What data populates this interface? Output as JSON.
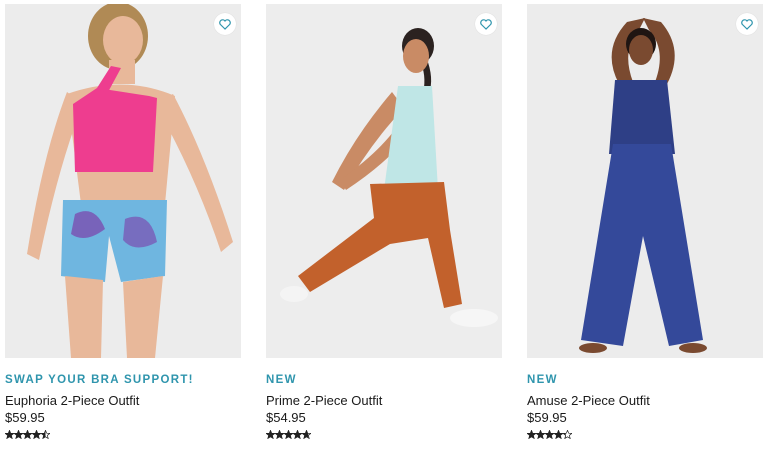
{
  "products": [
    {
      "badge": "SWAP YOUR BRA SUPPORT!",
      "name": "Euphoria 2-Piece Outfit",
      "price": "$59.95",
      "rating": 4.5,
      "wishlist_icon": "heart-outline-icon",
      "image_alt": "Model wearing pink one-shoulder sports bra and blue tie-dye shorts",
      "colors": {
        "top": "#ee3d8f",
        "bottom": "#6fb6e0",
        "bottom_accent": "#7a4fb0",
        "skin": "#e8b89a",
        "hair": "#b08a55"
      }
    },
    {
      "badge": "NEW",
      "name": "Prime 2-Piece Outfit",
      "price": "$54.95",
      "rating": 4.7,
      "wishlist_icon": "heart-outline-icon",
      "image_alt": "Model in lunge wearing light aqua tank and rust leggings",
      "colors": {
        "top": "#bfe6e6",
        "bottom": "#c2612c",
        "skin": "#c98b65",
        "hair": "#2b2220"
      }
    },
    {
      "badge": "NEW",
      "name": "Amuse 2-Piece Outfit",
      "price": "$59.95",
      "rating": 4.3,
      "wishlist_icon": "heart-outline-icon",
      "image_alt": "Model wearing navy tank and navy wide-leg pants",
      "colors": {
        "top": "#2e3f86",
        "bottom": "#34499a",
        "skin": "#7a4a30",
        "hair": "#1f1512"
      }
    }
  ],
  "colors": {
    "badge": "#2f95ad",
    "text": "#1a1a1a",
    "star": "#222222",
    "photo_bg": "#eeeeee",
    "heart": "#2f95ad"
  }
}
